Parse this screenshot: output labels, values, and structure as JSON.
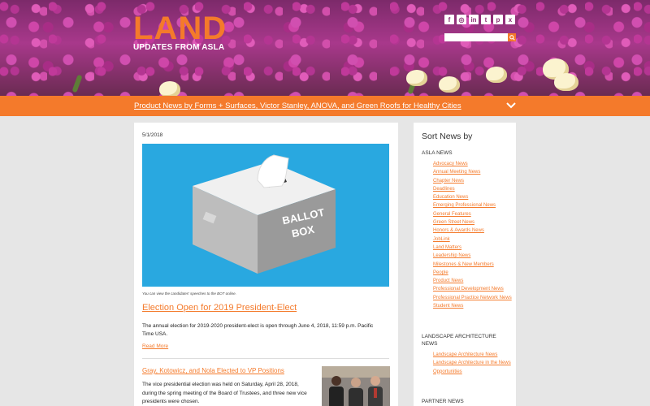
{
  "header": {
    "logo_word": "LAND",
    "logo_sub": "UPDATES FROM ASLA",
    "social": [
      {
        "name": "facebook-icon",
        "glyph": "f"
      },
      {
        "name": "instagram-icon",
        "glyph": "◎"
      },
      {
        "name": "linkedin-icon",
        "glyph": "in"
      },
      {
        "name": "twitter-icon",
        "glyph": "t"
      },
      {
        "name": "pinterest-icon",
        "glyph": "p"
      },
      {
        "name": "xing-icon",
        "glyph": "x"
      }
    ],
    "search_placeholder": "",
    "accent": "#f47a2b"
  },
  "banner": {
    "link_text": "Product News by Forms + Surfaces, Victor Stanley, ANOVA, and Green Roofs for Healthy Cities"
  },
  "article1": {
    "date": "5/1/2018",
    "image_box_text": [
      "BALLOT",
      "BOX"
    ],
    "caption": "You can view the candidates' speeches to the BOT online.",
    "title": "Election Open for 2019 President-Elect",
    "body": "The annual election for 2019-2020 president-elect is open through June 4, 2018, 11:59 p.m. Pacific Time USA.",
    "read_more": "Read More"
  },
  "article2": {
    "title": "Gray, Kotowicz, and Nola Elected to VP Positions",
    "body": "The vice presidential election was held on Saturday, April 28, 2018, during the spring meeting of the Board of Trustees, and three new vice presidents were chosen."
  },
  "sidebar": {
    "heading": "Sort News by",
    "asla_label": "ASLA NEWS",
    "asla_links": [
      "Advocacy News",
      "Annual Meeting News",
      "Chapter News",
      "Deadlines",
      "Education News",
      "Emerging Professional News",
      "General Features",
      "Green Street News",
      "Honors & Awards News",
      "JobLink",
      "Land Matters",
      "Leadership News",
      "Milestones & New Members",
      "People",
      "Product News",
      "Professional Development News",
      "Professional Practice Network News",
      "Student News"
    ],
    "la_label": "LANDSCAPE ARCHITECTURE NEWS",
    "la_links": [
      "Landscape Architecture News",
      "Landscape Architecture in the News",
      "Opportunities"
    ],
    "partner_label": "PARTNER NEWS"
  }
}
